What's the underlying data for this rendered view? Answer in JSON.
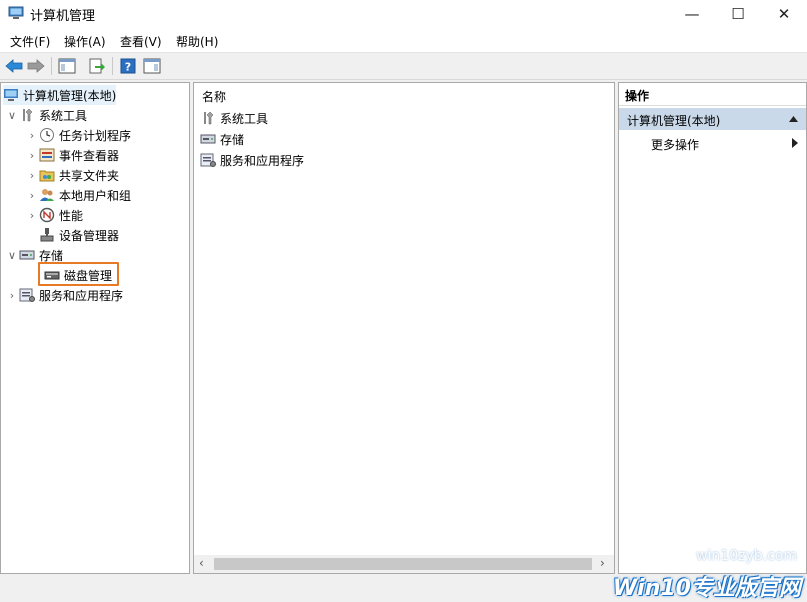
{
  "window": {
    "title": "计算机管理",
    "controls": {
      "minimize": "—",
      "maximize": "☐",
      "close": "✕"
    }
  },
  "menu": [
    "文件(F)",
    "操作(A)",
    "查看(V)",
    "帮助(H)"
  ],
  "tree": {
    "root": "计算机管理(本地)",
    "system_tools": "系统工具",
    "task_scheduler": "任务计划程序",
    "event_viewer": "事件查看器",
    "shared_folders": "共享文件夹",
    "local_users": "本地用户和组",
    "performance": "性能",
    "device_manager": "设备管理器",
    "storage": "存储",
    "disk_management": "磁盘管理",
    "services_apps": "服务和应用程序",
    "expanded_chevron": "∨",
    "collapsed_chevron": "›"
  },
  "list": {
    "header": "名称",
    "items": [
      "系统工具",
      "存储",
      "服务和应用程序"
    ]
  },
  "actions": {
    "header": "操作",
    "section": "计算机管理(本地)",
    "more": "更多操作"
  },
  "scroll": {
    "left": "‹",
    "right": "›"
  },
  "watermark": {
    "url": "win10zyb.com",
    "logo": "Win10专业版官网"
  },
  "colors": {
    "highlight": "#e87a26",
    "selection": "#c9d9ea"
  }
}
